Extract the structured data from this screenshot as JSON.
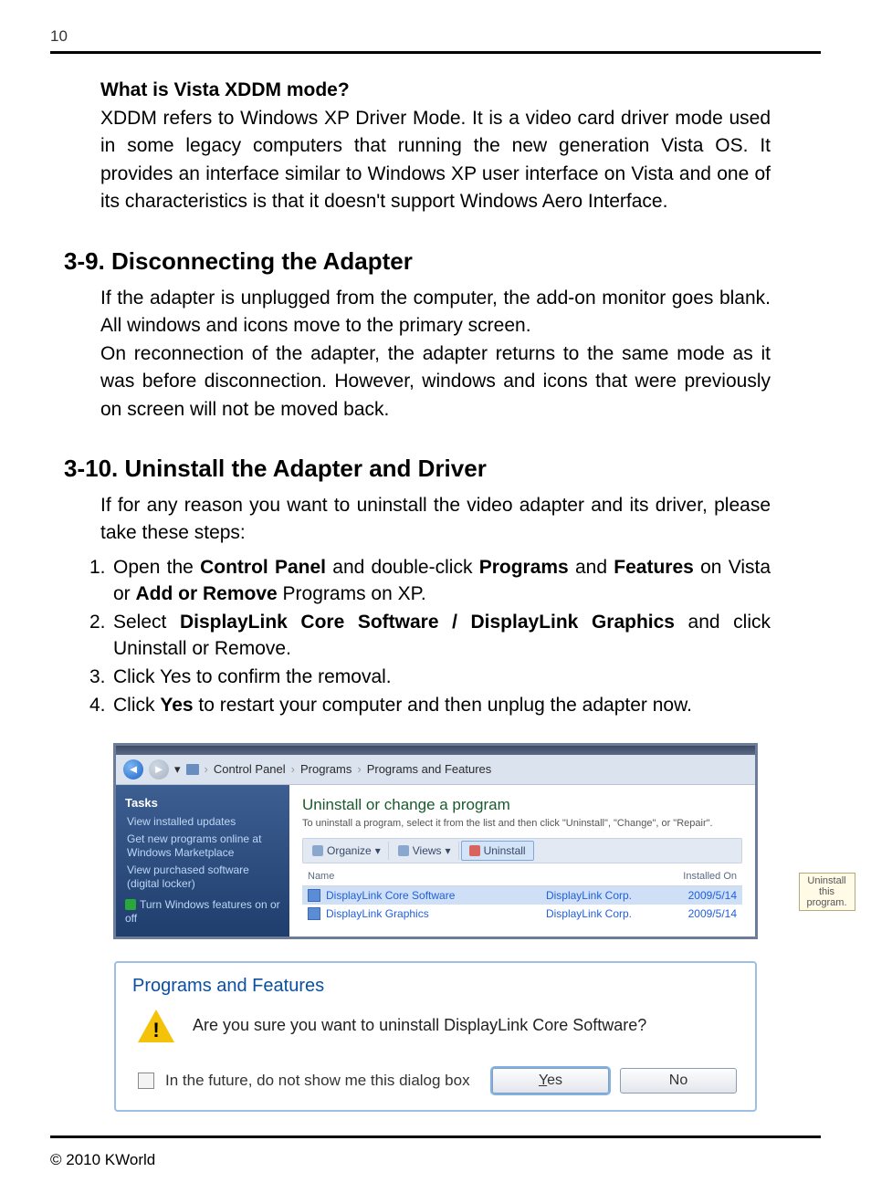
{
  "page_number": "10",
  "section_q": {
    "title": "What is Vista XDDM mode?",
    "body": "XDDM refers to Windows XP Driver Mode. It is a video card driver mode used in some legacy computers that running the new generation Vista OS. It provides an interface similar to Windows XP user interface on Vista and one of its characteristics is that it doesn't support Windows Aero Interface."
  },
  "sec39": {
    "heading": "3-9. Disconnecting the Adapter",
    "p1": "If the adapter is unplugged from the computer, the add-on monitor goes blank. All windows and icons move to the primary screen.",
    "p2": "On reconnection of the adapter, the adapter returns to the same mode as it was before disconnection. However, windows and icons that were previously on screen will not be moved back."
  },
  "sec310": {
    "heading": "3-10. Uninstall the Adapter and Driver",
    "intro": "If for any reason you want to uninstall the video adapter and its driver, please take these steps:",
    "steps": [
      {
        "num": "1.",
        "pre": "Open the ",
        "b1": "Control Panel",
        "mid": " and double-click ",
        "b2": "Programs",
        "mid2": " and ",
        "b3": "Features",
        "mid3": " on Vista or ",
        "b4": "Add or Remove",
        "post": " Programs on XP."
      },
      {
        "num": "2.",
        "pre": "Select ",
        "b1": "DisplayLink Core Software / DisplayLink Graphics",
        "post": " and click Uninstall or Remove."
      },
      {
        "num": "3.",
        "plain": "Click Yes to confirm the removal."
      },
      {
        "num": "4.",
        "pre": "Click ",
        "b1": "Yes",
        "post": " to restart your computer and then unplug the adapter now."
      }
    ]
  },
  "screenshot": {
    "breadcrumb": [
      "Control Panel",
      "Programs",
      "Programs and Features"
    ],
    "sidebar": {
      "tasks_label": "Tasks",
      "links": [
        "View installed updates",
        "Get new programs online at Windows Marketplace",
        "View purchased software (digital locker)",
        "Turn Windows features on or off"
      ]
    },
    "main": {
      "title": "Uninstall or change a program",
      "subtitle": "To uninstall a program, select it from the list and then click \"Uninstall\", \"Change\", or \"Repair\".",
      "toolbar": {
        "organize": "Organize",
        "views": "Views",
        "uninstall": "Uninstall"
      },
      "columns": {
        "name": "Name",
        "publisher_tooltip": "Uninstall this program.",
        "installed_on": "Installed On"
      },
      "rows": [
        {
          "name": "DisplayLink Core Software",
          "publisher": "DisplayLink Corp.",
          "date": "2009/5/14"
        },
        {
          "name": "DisplayLink Graphics",
          "publisher": "DisplayLink Corp.",
          "date": "2009/5/14"
        }
      ]
    }
  },
  "dialog": {
    "title": "Programs and Features",
    "message": "Are you sure you want to uninstall DisplayLink Core Software?",
    "checkbox_label": "In the future, do not show me this dialog box",
    "yes": "Yes",
    "no": "No"
  },
  "copyright": "© 2010 KWorld"
}
